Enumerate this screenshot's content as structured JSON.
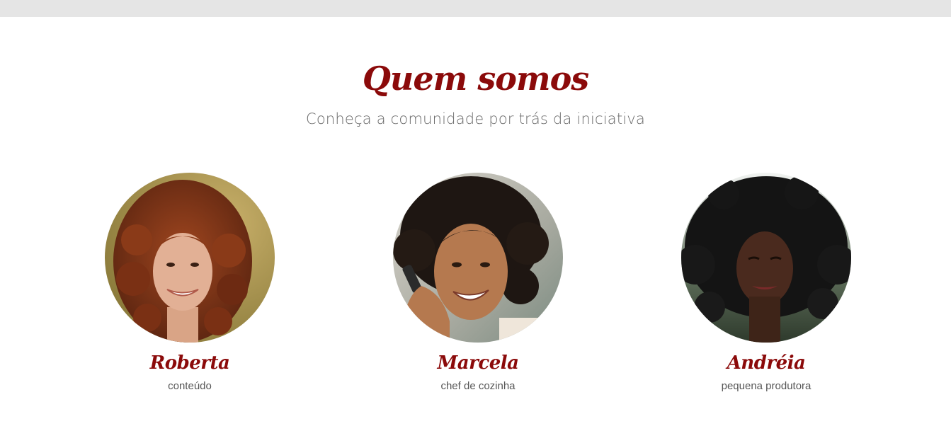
{
  "colors": {
    "top_bar": "#e5e5e5",
    "accent": "#8b0a0a",
    "subtitle": "#6b6b6b",
    "role_text": "#555555"
  },
  "section": {
    "title": "Quem somos",
    "subtitle": "Conheça a comunidade por trás da iniciativa"
  },
  "members": [
    {
      "name": "Roberta",
      "role": "conteúdo",
      "photo_alt": "Roberta photo"
    },
    {
      "name": "Marcela",
      "role": "chef de cozinha",
      "photo_alt": "Marcela photo"
    },
    {
      "name": "Andréia",
      "role": "pequena produtora",
      "photo_alt": "Andréia photo"
    }
  ]
}
